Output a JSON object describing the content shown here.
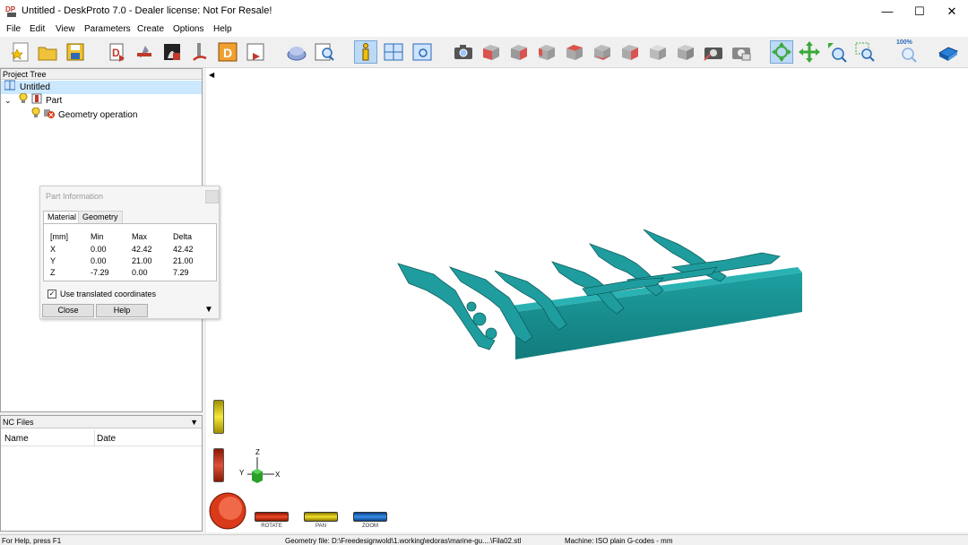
{
  "window": {
    "title": "Untitled - DeskProto 7.0 - Dealer license: Not For Resale!",
    "icon_label": "DP",
    "minimize": "—",
    "maximize": "☐",
    "close": "✕"
  },
  "menu": [
    "File",
    "Edit",
    "View",
    "Parameters",
    "Create",
    "Options",
    "Help"
  ],
  "toolbar": {
    "zoom_label": "100%",
    "buttons": [
      "new-project",
      "open-project",
      "save-project",
      "import-geometry",
      "part-parameters",
      "geometry-settings",
      "operation-parameters",
      "drawing",
      "save-toolpath",
      "simulate",
      "preview",
      "part-information",
      "layout",
      "view-settings",
      "camera",
      "view-front",
      "view-right",
      "view-back",
      "view-left",
      "view-top",
      "view-bottom",
      "view-iso",
      "view-iso-gray",
      "reset-view",
      "print-view",
      "rotate",
      "pan",
      "zoom-in",
      "zoom-window",
      "zoom-100",
      "about"
    ]
  },
  "project_tree": {
    "header": "Project Tree",
    "root": "Untitled",
    "part": "Part",
    "operation": "Geometry operation"
  },
  "nc_files": {
    "header": "NC Files",
    "columns": [
      "Name",
      "Date"
    ]
  },
  "dialog": {
    "title": "Part Information",
    "tabs": [
      "Material",
      "Geometry"
    ],
    "headers": [
      "[mm]",
      "Min",
      "Max",
      "Delta"
    ],
    "rows": [
      {
        "axis": "X",
        "min": "0.00",
        "max": "42.42",
        "delta": "42.42"
      },
      {
        "axis": "Y",
        "min": "0.00",
        "max": "21.00",
        "delta": "21.00"
      },
      {
        "axis": "Z",
        "min": "-7.29",
        "max": "0.00",
        "delta": "7.29"
      }
    ],
    "checkbox_label": "Use translated coordinates",
    "checkbox_checked": true,
    "close_label": "Close",
    "help_label": "Help"
  },
  "axes": {
    "z": "Z",
    "y": "Y",
    "x": "X"
  },
  "view_controls": {
    "rotate": "ROTATE",
    "pan": "PAN",
    "zoom": "ZOOM"
  },
  "status": {
    "help": "For Help, press F1",
    "geometry": "Geometry file: D:\\Freedesignwold\\1.working\\edoras\\marine-gu....\\Fila02.stl",
    "machine": "Machine: ISO plain G-codes - mm"
  },
  "colors": {
    "model": "#1a9c9c",
    "model_dark": "#0f6f70",
    "selection": "#cce8ff",
    "rotate": "#d93a1a",
    "pan": "#d8c81c",
    "zoom": "#2a7fd6"
  }
}
